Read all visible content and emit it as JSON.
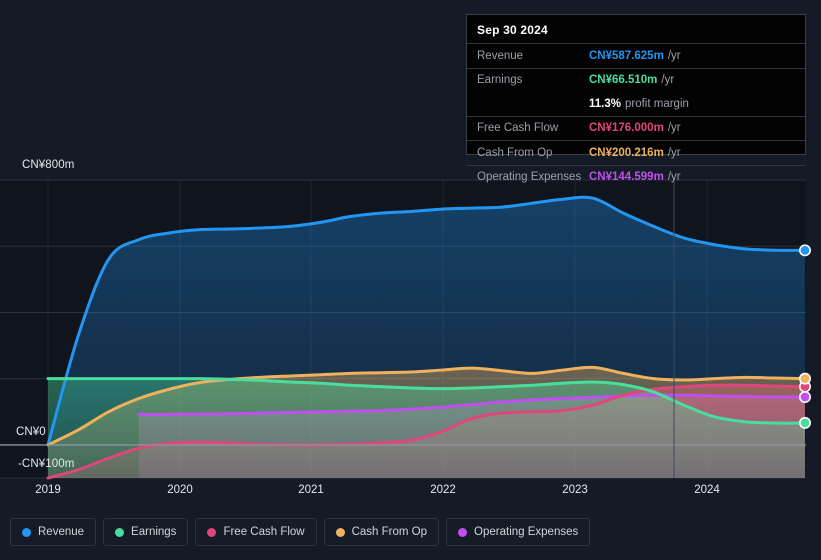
{
  "chart_data": {
    "type": "area",
    "title": "",
    "xlabel": "",
    "ylabel": "",
    "currency_prefix": "CN¥",
    "x_ticks": [
      "2019",
      "2020",
      "2021",
      "2022",
      "2023",
      "2024"
    ],
    "y_ticks": [
      "CN¥800m",
      "CN¥0",
      "-CN¥100m"
    ],
    "ylim": [
      -100,
      800
    ],
    "grid": true,
    "legend_position": "bottom",
    "series": [
      {
        "name": "Revenue",
        "color": "#2196f3",
        "values": [
          0,
          330,
          560,
          620,
          640,
          650,
          652,
          655,
          660,
          672,
          690,
          700,
          705,
          712,
          715,
          718,
          730,
          742,
          745,
          700,
          660,
          625,
          605,
          592,
          588,
          587.625
        ]
      },
      {
        "name": "Earnings",
        "color": "#4ade9e",
        "values": [
          200,
          200,
          200,
          200,
          200,
          200,
          198,
          195,
          190,
          186,
          180,
          176,
          172,
          170,
          172,
          176,
          180,
          186,
          190,
          182,
          160,
          120,
          85,
          70,
          66,
          66.51
        ]
      },
      {
        "name": "Free Cash Flow",
        "color": "#e0457b",
        "values": [
          -100,
          -75,
          -40,
          -10,
          5,
          8,
          6,
          2,
          0,
          0,
          2,
          6,
          14,
          40,
          80,
          96,
          100,
          104,
          120,
          150,
          168,
          176,
          180,
          180,
          178,
          176.0
        ]
      },
      {
        "name": "Cash From Op",
        "color": "#efb15c",
        "values": [
          0,
          45,
          100,
          140,
          168,
          188,
          198,
          204,
          208,
          212,
          216,
          218,
          220,
          226,
          232,
          224,
          216,
          226,
          234,
          216,
          200,
          196,
          200,
          204,
          202,
          200.216
        ]
      },
      {
        "name": "Operating Expenses",
        "color": "#c04ff0",
        "values": [
          null,
          null,
          null,
          92,
          92,
          93,
          94,
          96,
          98,
          100,
          102,
          104,
          108,
          114,
          122,
          130,
          136,
          140,
          144,
          148,
          150,
          150,
          148,
          146,
          145,
          144.599
        ]
      }
    ]
  },
  "tooltip": {
    "date": "Sep 30 2024",
    "rows": [
      {
        "label": "Revenue",
        "value": "CN¥587.625m",
        "unit": "/yr",
        "color": "#2196f3"
      },
      {
        "label": "Earnings",
        "value": "CN¥66.510m",
        "unit": "/yr",
        "color": "#4ade9e"
      },
      {
        "label": "",
        "value": "11.3%",
        "unit": "profit margin",
        "color": "#ffffff",
        "sub": true
      },
      {
        "label": "Free Cash Flow",
        "value": "CN¥176.000m",
        "unit": "/yr",
        "color": "#e0457b"
      },
      {
        "label": "Cash From Op",
        "value": "CN¥200.216m",
        "unit": "/yr",
        "color": "#efb15c"
      },
      {
        "label": "Operating Expenses",
        "value": "CN¥144.599m",
        "unit": "/yr",
        "color": "#c04ff0"
      }
    ]
  },
  "legend": {
    "items": [
      {
        "label": "Revenue",
        "color": "#2196f3"
      },
      {
        "label": "Earnings",
        "color": "#4ade9e"
      },
      {
        "label": "Free Cash Flow",
        "color": "#e0457b"
      },
      {
        "label": "Cash From Op",
        "color": "#efb15c"
      },
      {
        "label": "Operating Expenses",
        "color": "#c04ff0"
      }
    ]
  },
  "axis": {
    "y_top": "CN¥800m",
    "y_zero": "CN¥0",
    "y_negative": "-CN¥100m"
  },
  "colors": {
    "background": "#151b26",
    "plot_background": "#10141d",
    "gridline": "#2a3140",
    "zero_line": "#8d93a0"
  }
}
